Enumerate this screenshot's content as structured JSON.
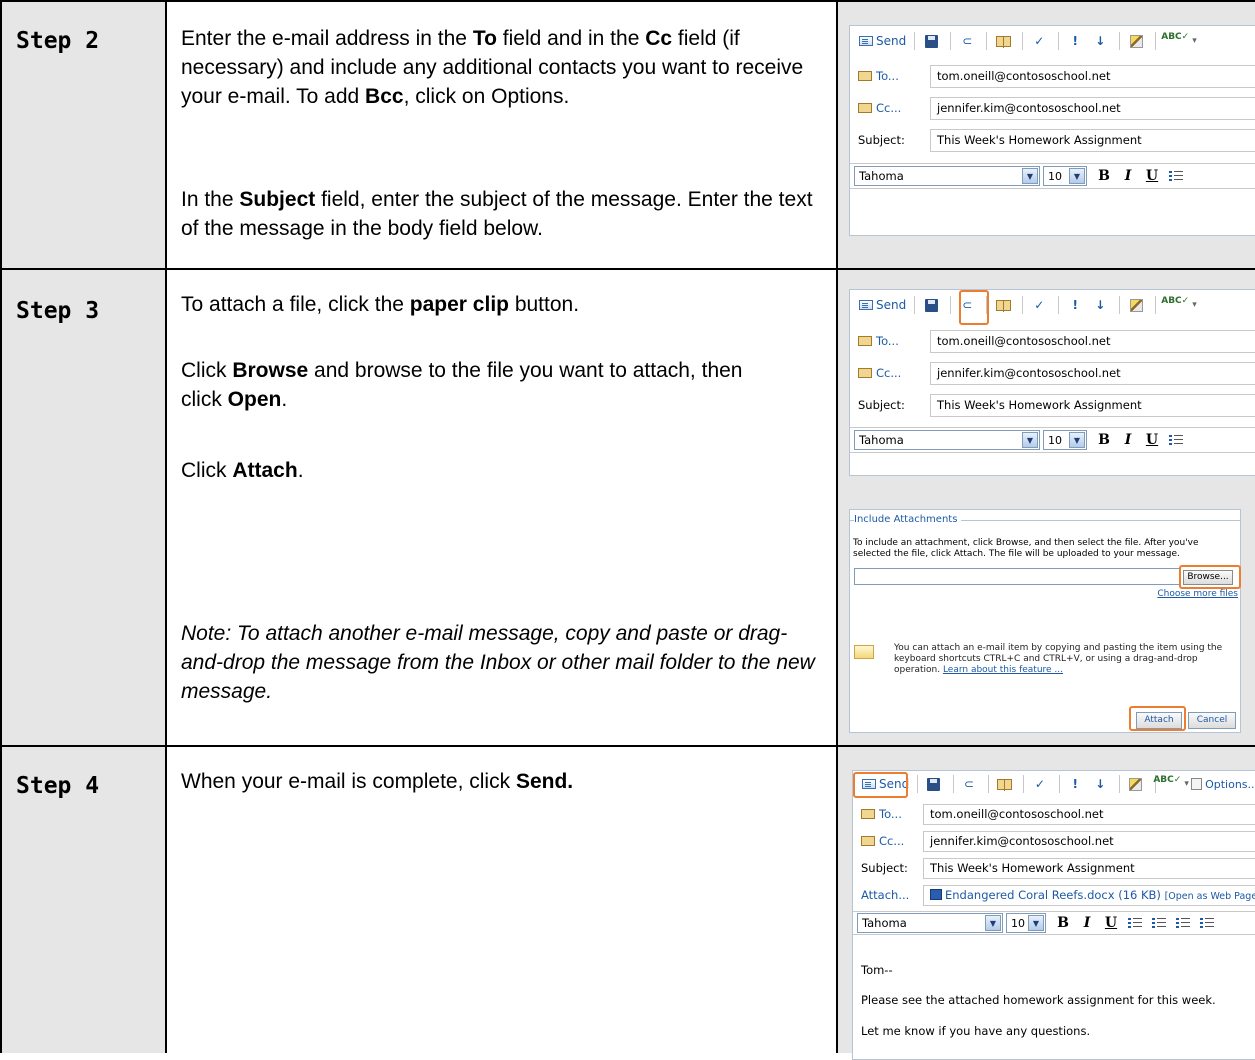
{
  "steps": [
    {
      "label": "Step 2",
      "paragraphs": [
        {
          "t1": "Enter the e-mail address in the ",
          "b1": "To",
          "t2": " field and in the ",
          "b2": "Cc",
          "t3": " field (if necessary) and include any additional contacts you want to receive your e-mail. To add ",
          "b3": "Bcc",
          "t4": ", click on Options."
        },
        {
          "t1": "In the ",
          "b1": "Subject",
          "t2": " field, enter the subject of the message. Enter the text of the message in the body field below."
        }
      ]
    },
    {
      "label": "Step 3",
      "paragraphs": [
        {
          "t1": "To attach a file, click the ",
          "b1": "paper clip",
          "t2": " button."
        },
        {
          "t1": "Click ",
          "b1": "Browse",
          "t2": " and browse to the file you want to attach, then click ",
          "b2": "Open",
          "t3": "."
        },
        {
          "t1": "Click ",
          "b1": "Attach",
          "t2": "."
        },
        {
          "note": "Note: To attach another e-mail message, copy and paste or drag-and-drop the message from the Inbox or other mail folder to the new message."
        }
      ]
    },
    {
      "label": "Step 4",
      "paragraphs": [
        {
          "t1": "When your e-mail is complete, click ",
          "b1": "Send."
        }
      ]
    }
  ],
  "compose": {
    "send": "Send",
    "options": "Options...",
    "to_label": "To...",
    "cc_label": "Cc...",
    "subject_label": "Subject:",
    "attach_label": "Attach...",
    "to_value": "tom.oneill@contososchool.net",
    "cc_value": "jennifer.kim@contososchool.net",
    "subject_value": "This Week's Homework Assignment",
    "font": "Tahoma",
    "size": "10",
    "bold": "B",
    "italic": "I",
    "underline": "U",
    "attachment_name": "Endangered Coral Reefs.docx (16 KB)",
    "attachment_open": "[Open as Web Page]",
    "body_greeting": "Tom--",
    "body_line1": "Please see the attached homework assignment for this week.",
    "body_line2": "Let me know if you have any questions."
  },
  "dialog": {
    "title": "Include Attachments",
    "instructions": "To include an attachment, click Browse, and then select the file. After you've selected the file, click Attach. The file will be uploaded to your message.",
    "browse": "Browse...",
    "choose_more": "Choose more files",
    "hint": "You can attach an e-mail item by copying and pasting the item using the keyboard shortcuts CTRL+C and CTRL+V, or using a drag-and-drop operation. ",
    "hint_link": "Learn about this feature ...",
    "attach": "Attach",
    "cancel": "Cancel"
  },
  "colors": {
    "highlight": "#ed7d31",
    "link": "#1c5aa6",
    "cell_gray": "#e6e6e6"
  }
}
